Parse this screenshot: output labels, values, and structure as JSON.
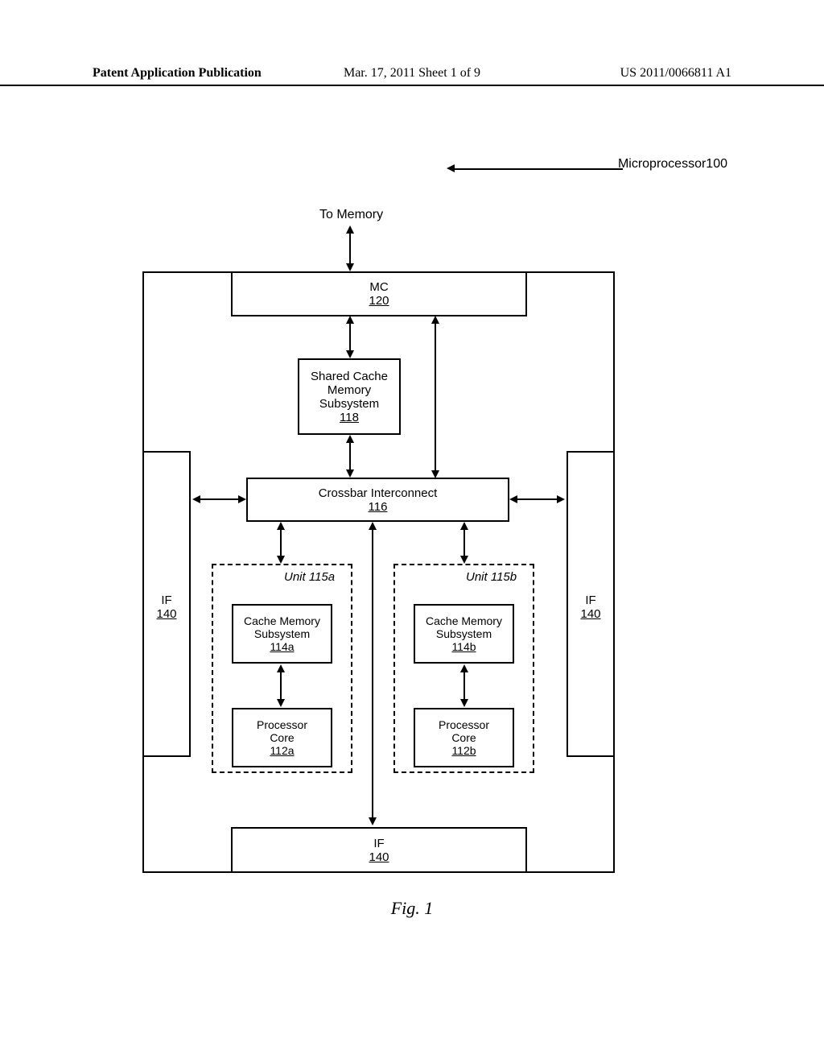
{
  "header": {
    "left": "Patent Application Publication",
    "center": "Mar. 17, 2011  Sheet 1 of 9",
    "right": "US 2011/0066811 A1"
  },
  "diagram": {
    "title_label": "Microprocessor100",
    "to_memory": "To Memory",
    "mc": {
      "label": "MC",
      "ref": "120"
    },
    "shared_cache": {
      "line1": "Shared Cache",
      "line2": "Memory",
      "line3": "Subsystem",
      "ref": "118"
    },
    "crossbar": {
      "label": "Crossbar Interconnect",
      "ref": "116"
    },
    "if_left": {
      "label": "IF",
      "ref": "140"
    },
    "if_right": {
      "label": "IF",
      "ref": "140"
    },
    "if_bottom": {
      "label": "IF",
      "ref": "140"
    },
    "unit_a": {
      "label": "Unit 115a"
    },
    "unit_b": {
      "label": "Unit 115b"
    },
    "cache_a": {
      "line1": "Cache Memory",
      "line2": "Subsystem",
      "ref": "114a"
    },
    "cache_b": {
      "line1": "Cache Memory",
      "line2": "Subsystem",
      "ref": "114b"
    },
    "proc_a": {
      "line1": "Processor",
      "line2": "Core",
      "ref": "112a"
    },
    "proc_b": {
      "line1": "Processor",
      "line2": "Core",
      "ref": "112b"
    }
  },
  "figure_label": "Fig. 1"
}
